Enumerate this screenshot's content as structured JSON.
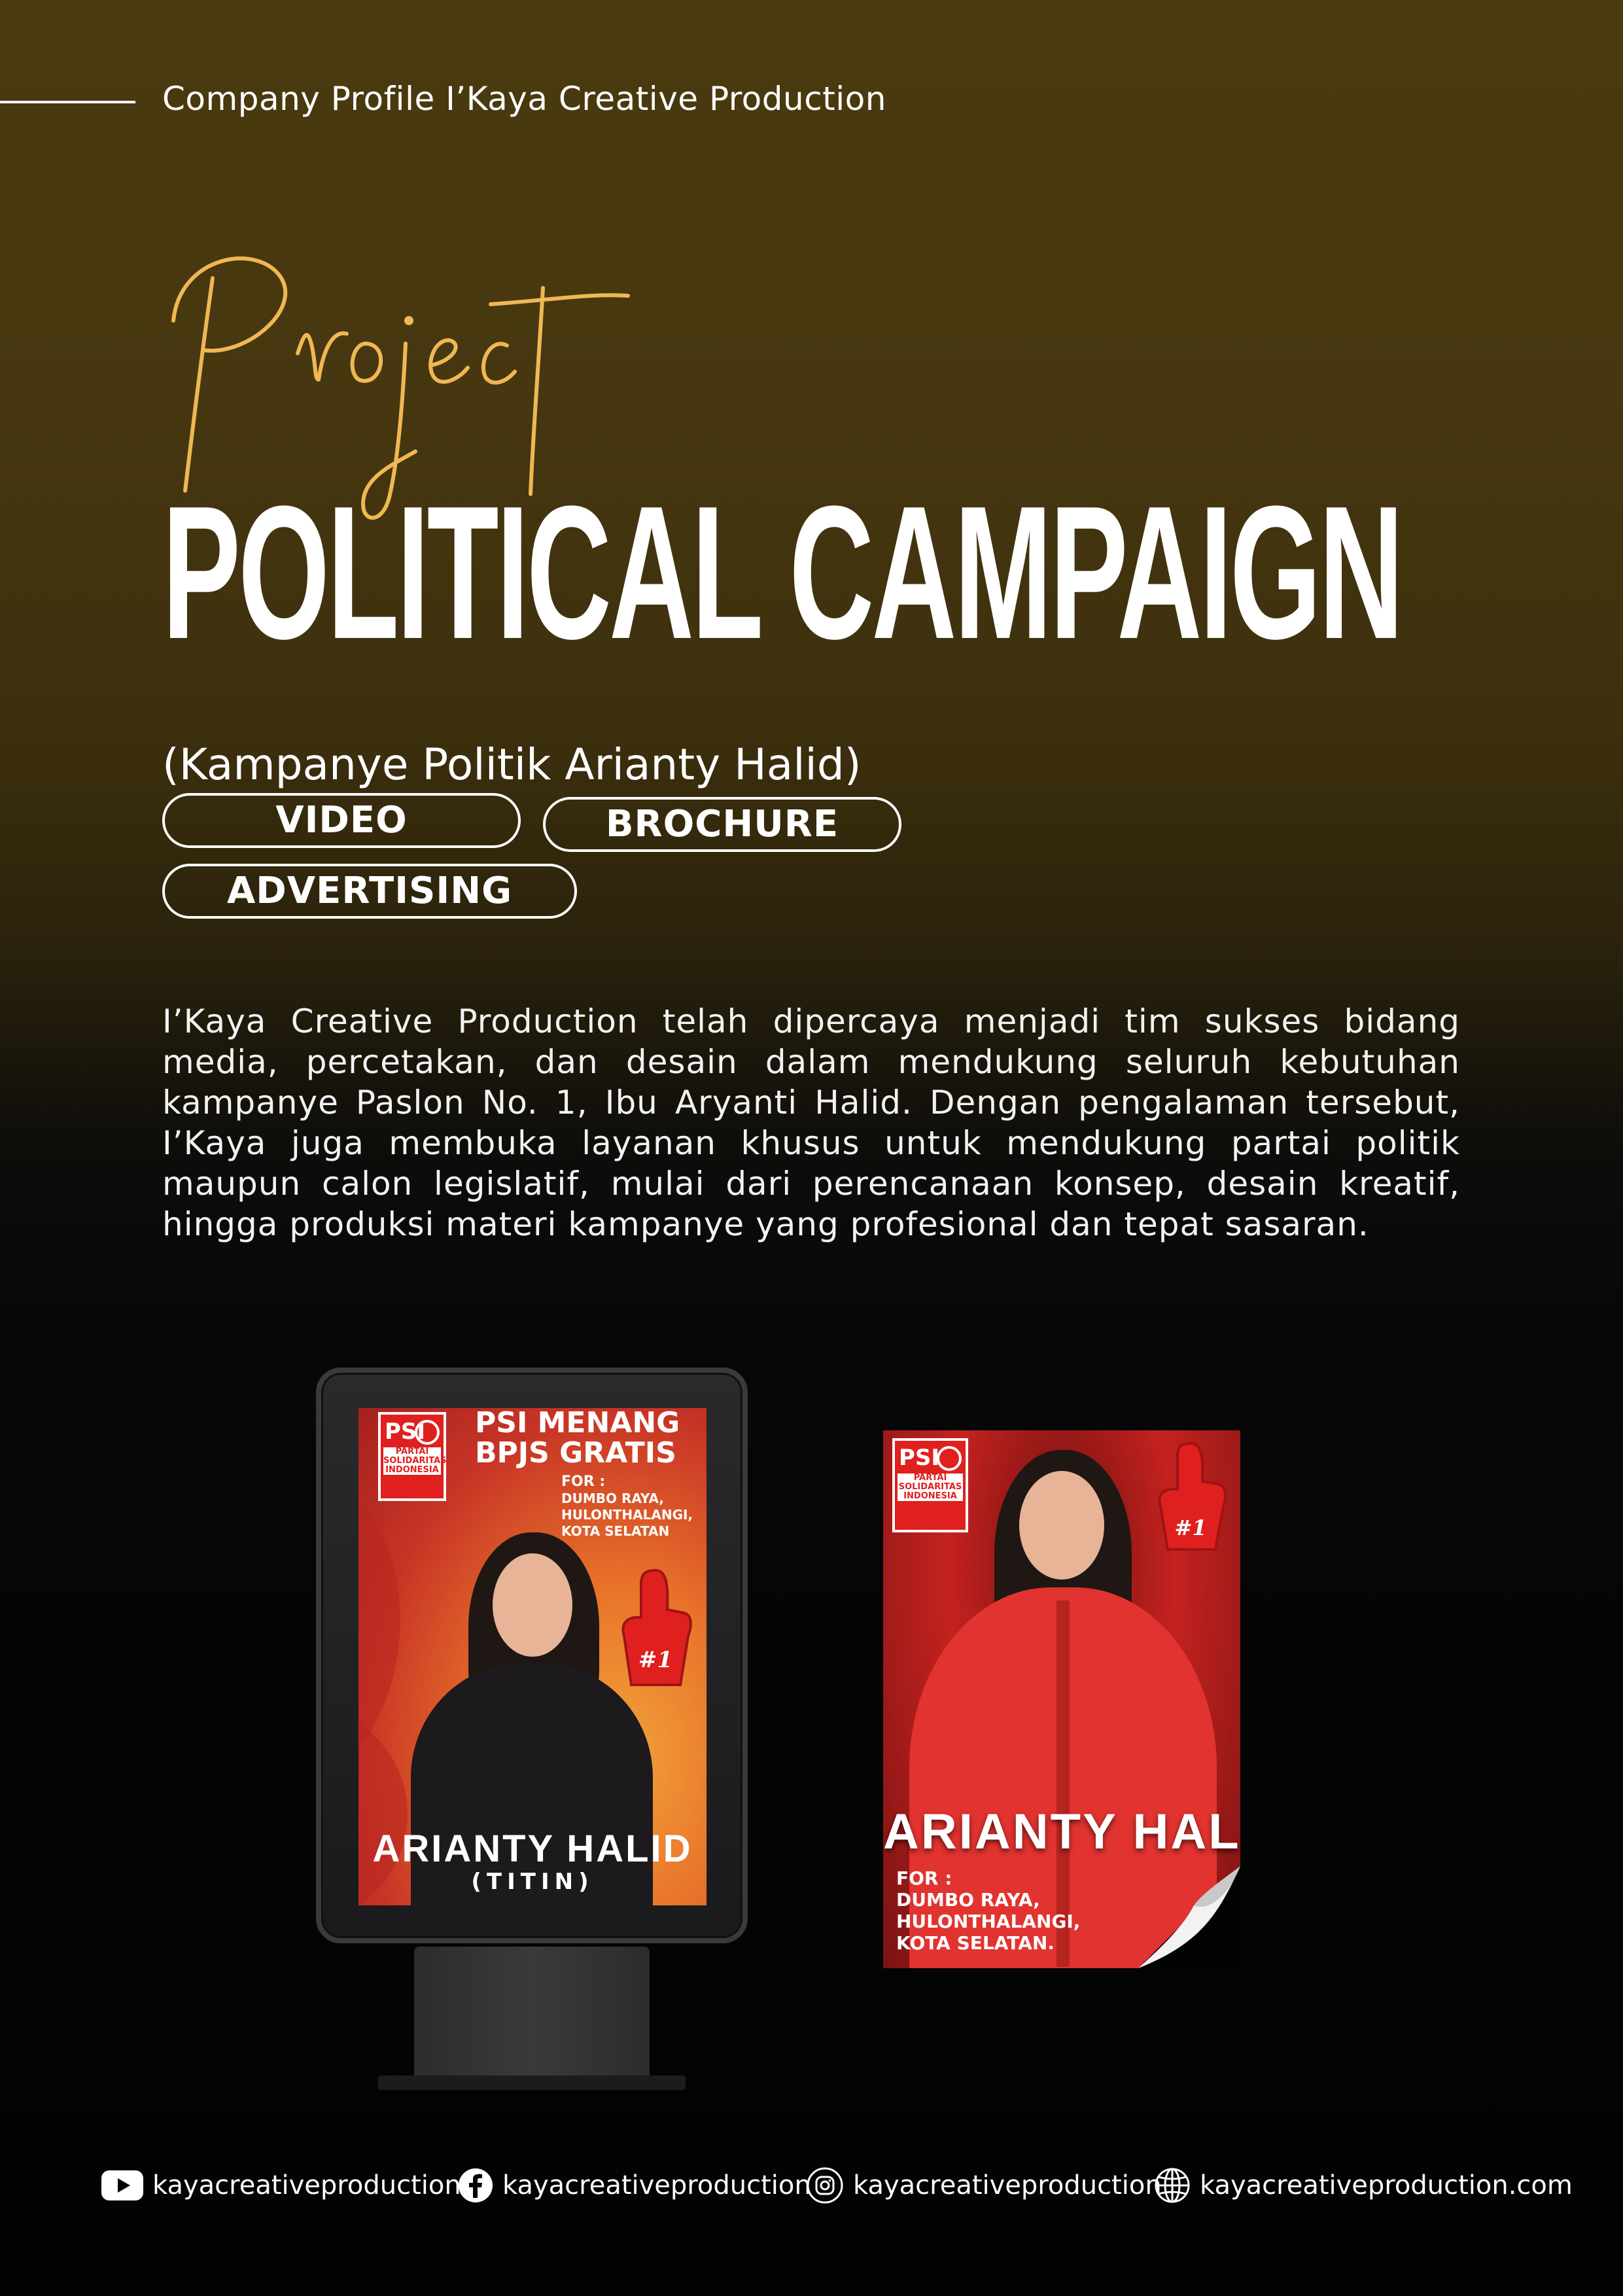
{
  "header": {
    "text": "Company Profile I’Kaya Creative Production"
  },
  "title": {
    "script_word": "Project",
    "main": "POLITICAL CAMPAIGN",
    "subtitle": "(Kampanye Politik Arianty Halid)"
  },
  "services": [
    "VIDEO",
    "BROCHURE",
    "ADVERTISING"
  ],
  "description": "I’Kaya Creative Production telah dipercaya menjadi tim sukses bidang media, percetakan, dan desain dalam mendukung seluruh kebutuhan kampanye Paslon No. 1, Ibu Aryanti Halid. Dengan pengalaman tersebut, I’Kaya juga membuka layanan khusus untuk mendukung partai politik maupun calon legislatif, mulai dari perencanaan konsep, desain kreatif, hingga produksi materi kampanye yang profesional dan tepat sasaran.",
  "billboard": {
    "logo_text": "PSI",
    "logo_sub": "PARTAI SOLIDARITAS INDONESIA",
    "headline_1": "PSI MENANG",
    "headline_2": "BPJS GRATIS",
    "for_label": "FOR :",
    "for_areas": "DUMBO RAYA, HULONTHALANGI, KOTA SELATAN",
    "badge": "#1",
    "name": "ARIANTY HALID",
    "nickname": "(TITIN)"
  },
  "brochure": {
    "logo_text": "PSI",
    "logo_sub": "PARTAI SOLIDARITAS INDONESIA",
    "badge": "#1",
    "name": "ARIANTY HALID",
    "for_label": "FOR :",
    "for_line_1": "DUMBO RAYA,",
    "for_line_2": "HULONTHALANGI,",
    "for_line_3": "KOTA SELATAN."
  },
  "footer": {
    "youtube": "kayacreativeproduction",
    "facebook": "kayacreativeproduction",
    "instagram": "kayacreativeproduction",
    "website": "kayacreativeproduction.com"
  },
  "colors": {
    "script_gold": "#f0b752",
    "psi_red": "#e0201f"
  }
}
